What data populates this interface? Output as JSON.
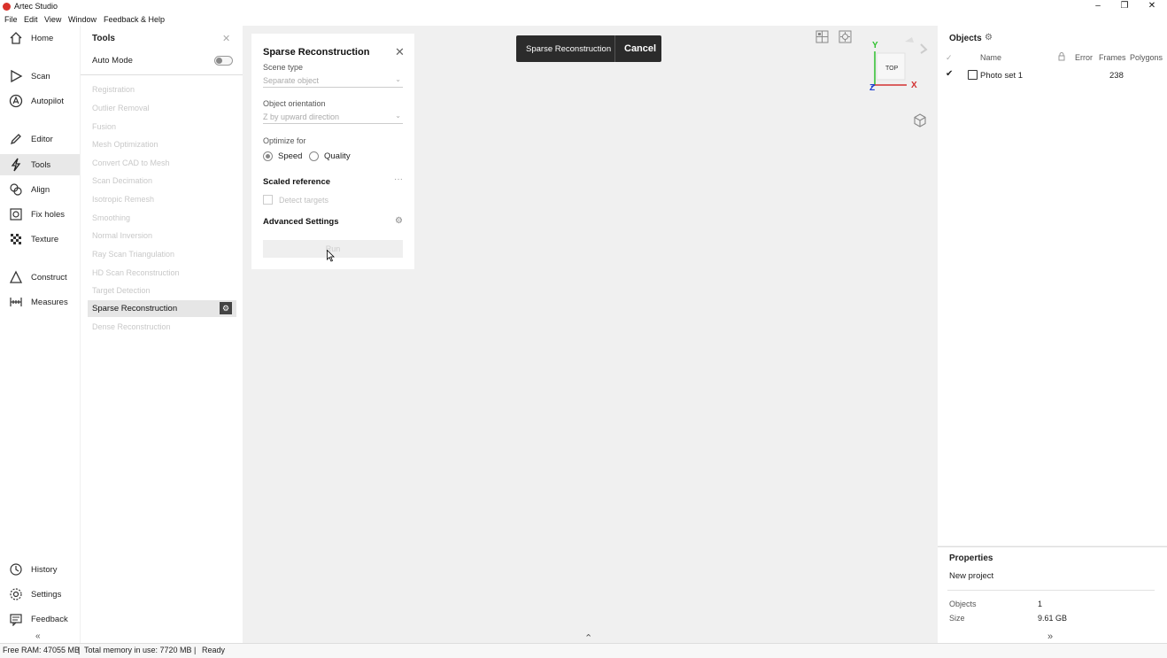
{
  "window": {
    "title": "Artec Studio",
    "min": "–",
    "restore": "❐",
    "close": "✕"
  },
  "menu": [
    "File",
    "Edit",
    "View",
    "Window",
    "Feedback & Help"
  ],
  "nav": {
    "top": [
      {
        "label": "Home",
        "icon": "home-icon"
      },
      {
        "label": "Scan",
        "icon": "scan-icon"
      },
      {
        "label": "Autopilot",
        "icon": "autopilot-icon"
      },
      {
        "label": "Editor",
        "icon": "editor-icon"
      },
      {
        "label": "Tools",
        "icon": "tools-icon"
      },
      {
        "label": "Align",
        "icon": "align-icon"
      },
      {
        "label": "Fix holes",
        "icon": "fix-holes-icon"
      },
      {
        "label": "Texture",
        "icon": "texture-icon"
      },
      {
        "label": "Construct",
        "icon": "construct-icon"
      },
      {
        "label": "Measures",
        "icon": "measures-icon"
      }
    ],
    "bottom": [
      {
        "label": "History",
        "icon": "history-icon"
      },
      {
        "label": "Settings",
        "icon": "settings-icon"
      },
      {
        "label": "Feedback",
        "icon": "feedback-icon"
      }
    ],
    "collapse": "«"
  },
  "tools": {
    "title": "Tools",
    "close": "✕",
    "auto_mode": "Auto Mode",
    "items": [
      "Registration",
      "Outlier Removal",
      "Fusion",
      "Mesh Optimization",
      "Convert CAD to Mesh",
      "Scan Decimation",
      "Isotropic Remesh",
      "Smoothing",
      "Normal Inversion",
      "Ray Scan Triangulation",
      "HD Scan Reconstruction",
      "Target Detection"
    ],
    "active": "Sparse Reconstruction",
    "after": [
      "Dense Reconstruction"
    ]
  },
  "dialog": {
    "title": "Sparse Reconstruction",
    "close": "✕",
    "scene_type_label": "Scene type",
    "scene_type_value": "Separate object",
    "orientation_label": "Object orientation",
    "orientation_value": "Z by upward direction",
    "optimize_label": "Optimize for",
    "speed": "Speed",
    "quality": "Quality",
    "scaled_reference": "Scaled reference",
    "more": "···",
    "detect_targets": "Detect targets",
    "advanced": "Advanced Settings",
    "run": "Run"
  },
  "viewport": {
    "mode": "Sparse Reconstruction",
    "cancel": "Cancel",
    "axis_y": "Y",
    "axis_x": "X",
    "axis_z": "Z",
    "view_top": "TOP",
    "expand": "⌃"
  },
  "objects": {
    "title": "Objects",
    "columns": {
      "check": "✓",
      "name": "Name",
      "error": "Error",
      "frames": "Frames",
      "polygons": "Polygons"
    },
    "rows": [
      {
        "check": "✔",
        "name": "Photo set 1",
        "frames": "238"
      }
    ]
  },
  "properties": {
    "title": "Properties",
    "project": "New project",
    "objects_key": "Objects",
    "objects_val": "1",
    "size_key": "Size",
    "size_val": "9.61 GB",
    "expand": "»"
  },
  "status": {
    "free_ram": "Free RAM: 47055 MB",
    "total_mem": "Total memory in use: 7720 MB",
    "state": "Ready",
    "sep": "|"
  }
}
